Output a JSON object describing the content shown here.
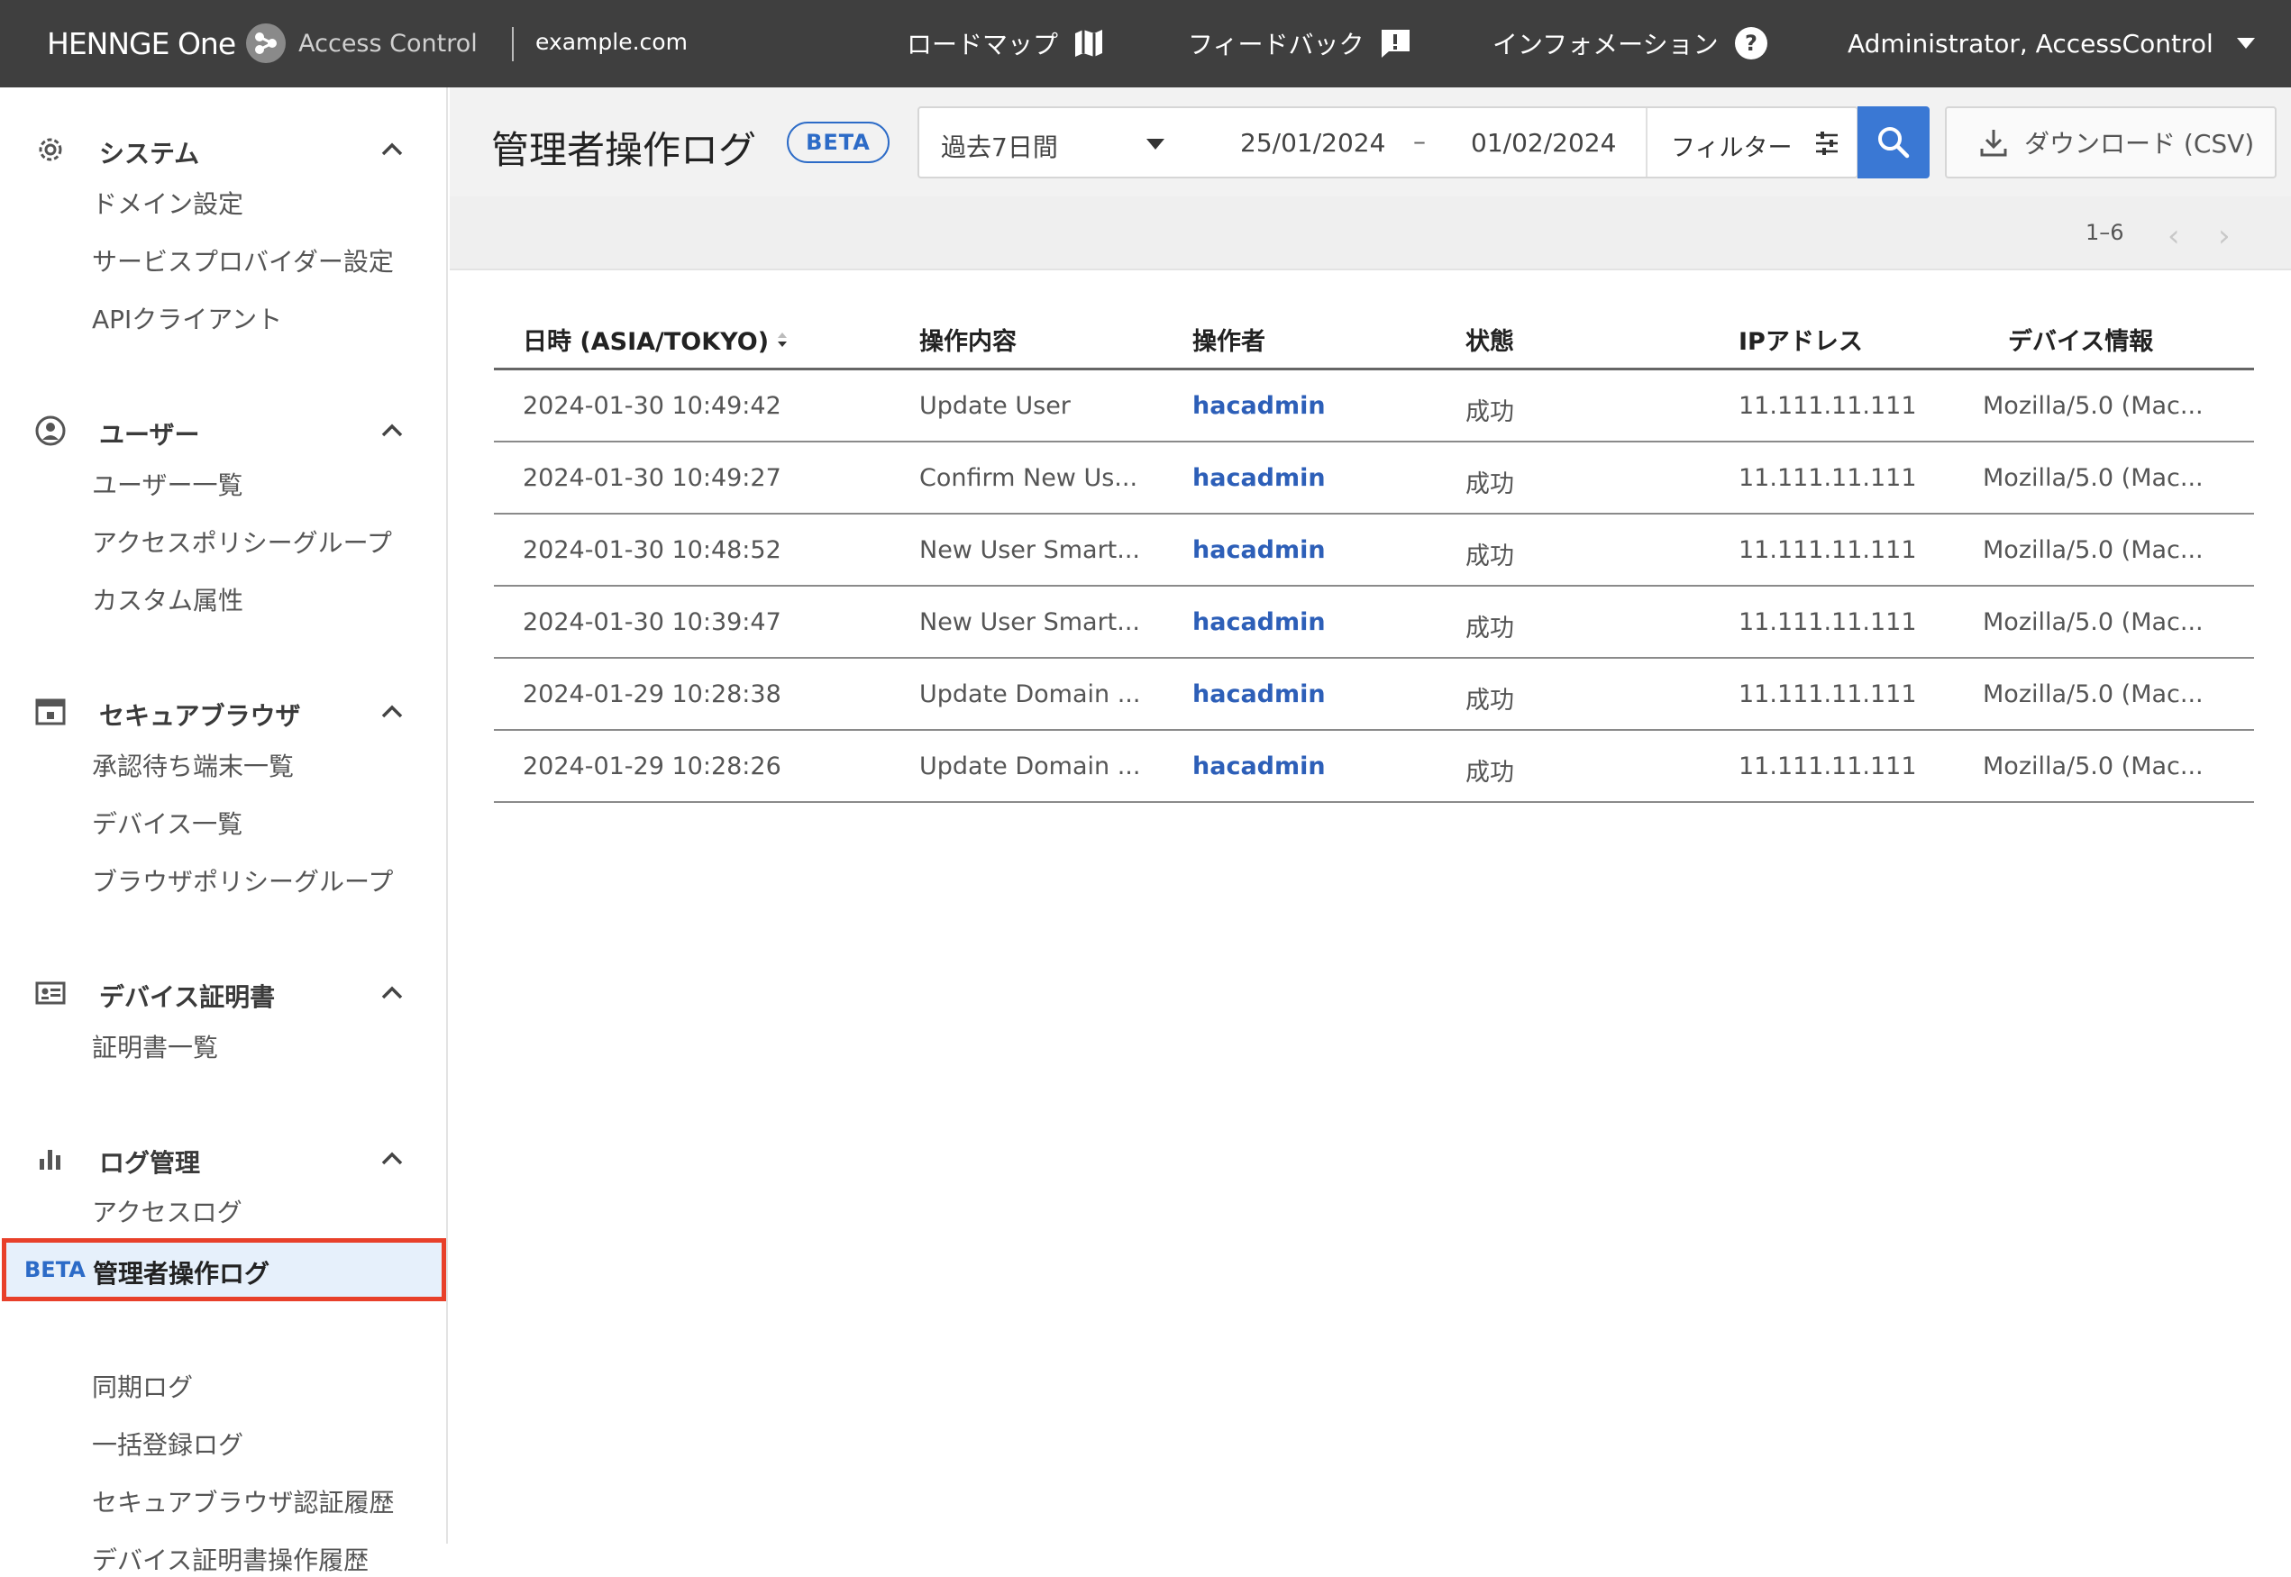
{
  "header": {
    "brand": "HENNGE One",
    "product": "Access Control",
    "domain": "example.com",
    "nav": [
      {
        "label": "ロードマップ",
        "icon": "map-icon"
      },
      {
        "label": "フィードバック",
        "icon": "feedback-icon"
      },
      {
        "label": "インフォメーション",
        "icon": "help-icon"
      }
    ],
    "user": "Administrator, AccessControl"
  },
  "sidebar": {
    "sections": [
      {
        "title": "システム",
        "icon": "gear-icon",
        "items": [
          "ドメイン設定",
          "サービスプロバイダー設定",
          "APIクライアント"
        ]
      },
      {
        "title": "ユーザー",
        "icon": "user-circle-icon",
        "items": [
          "ユーザー一覧",
          "アクセスポリシーグループ",
          "カスタム属性"
        ]
      },
      {
        "title": "セキュアブラウザ",
        "icon": "browser-icon",
        "items": [
          "承認待ち端末一覧",
          "デバイス一覧",
          "ブラウザポリシーグループ"
        ]
      },
      {
        "title": "デバイス証明書",
        "icon": "certificate-icon",
        "items": [
          "証明書一覧"
        ]
      },
      {
        "title": "ログ管理",
        "icon": "bar-chart-icon",
        "items": [
          "アクセスログ",
          "管理者操作ログ",
          "同期ログ",
          "一括登録ログ",
          "セキュアブラウザ認証履歴",
          "デバイス証明書操作履歴"
        ]
      }
    ],
    "active_item": {
      "badge": "BETA",
      "label": "管理者操作ログ"
    }
  },
  "main": {
    "title": "管理者操作ログ",
    "badge": "BETA",
    "filter": {
      "range": "過去7日間",
      "date_from": "25/01/2024",
      "date_sep": "–",
      "date_to": "01/02/2024",
      "filter_label": "フィルター"
    },
    "download_label": "ダウンロード (CSV)",
    "pager": {
      "range": "1–6",
      "prev": "‹",
      "next": "›"
    },
    "table": {
      "columns": [
        "日時 (ASIA/TOKYO)",
        "操作内容",
        "操作者",
        "状態",
        "IPアドレス",
        "デバイス情報"
      ],
      "rows": [
        {
          "datetime": "2024-01-30 10:49:42",
          "action": "Update User",
          "operator": "hacadmin",
          "status": "成功",
          "ip": "11.111.11.111",
          "device": "Mozilla/5.0 (Mac..."
        },
        {
          "datetime": "2024-01-30 10:49:27",
          "action": "Confirm New Us...",
          "operator": "hacadmin",
          "status": "成功",
          "ip": "11.111.11.111",
          "device": "Mozilla/5.0 (Mac..."
        },
        {
          "datetime": "2024-01-30 10:48:52",
          "action": "New User Smart...",
          "operator": "hacadmin",
          "status": "成功",
          "ip": "11.111.11.111",
          "device": "Mozilla/5.0 (Mac..."
        },
        {
          "datetime": "2024-01-30 10:39:47",
          "action": "New User Smart...",
          "operator": "hacadmin",
          "status": "成功",
          "ip": "11.111.11.111",
          "device": "Mozilla/5.0 (Mac..."
        },
        {
          "datetime": "2024-01-29 10:28:38",
          "action": "Update Domain ...",
          "operator": "hacadmin",
          "status": "成功",
          "ip": "11.111.11.111",
          "device": "Mozilla/5.0 (Mac..."
        },
        {
          "datetime": "2024-01-29 10:28:26",
          "action": "Update Domain ...",
          "operator": "hacadmin",
          "status": "成功",
          "ip": "11.111.11.111",
          "device": "Mozilla/5.0 (Mac..."
        }
      ]
    }
  },
  "colors": {
    "topbar": "#3f3f3f",
    "accent": "#3a78d4",
    "link": "#2d5fb8",
    "highlight_border": "#e8402a",
    "highlight_bg": "#e6f0fb"
  }
}
